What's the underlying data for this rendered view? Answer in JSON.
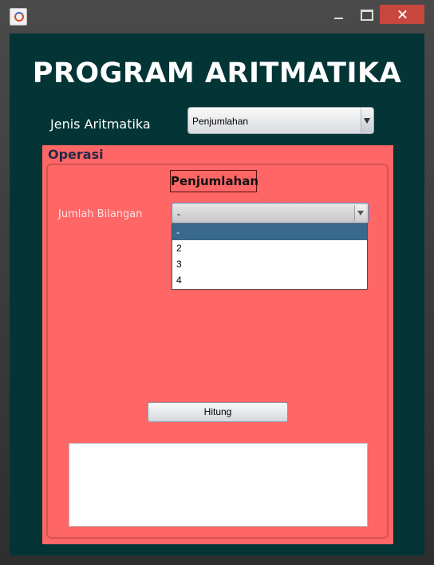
{
  "window": {
    "title": ""
  },
  "app": {
    "title": "PROGRAM ARITMATIKA"
  },
  "jenis": {
    "label": "Jenis Aritmatika",
    "selected": "Penjumlahan"
  },
  "panel": {
    "title": "Operasi",
    "operation_label": "Penjumlahan",
    "jumlah_label": "Jumlah Bilangan",
    "jumlah_selected": "-",
    "jumlah_options": [
      "-",
      "2",
      "3",
      "4"
    ],
    "hitung_label": "Hitung",
    "result_text": ""
  },
  "colors": {
    "background": "#033536",
    "panel": "#ff6666",
    "selection": "#39698c",
    "close_button": "#c7463d"
  }
}
